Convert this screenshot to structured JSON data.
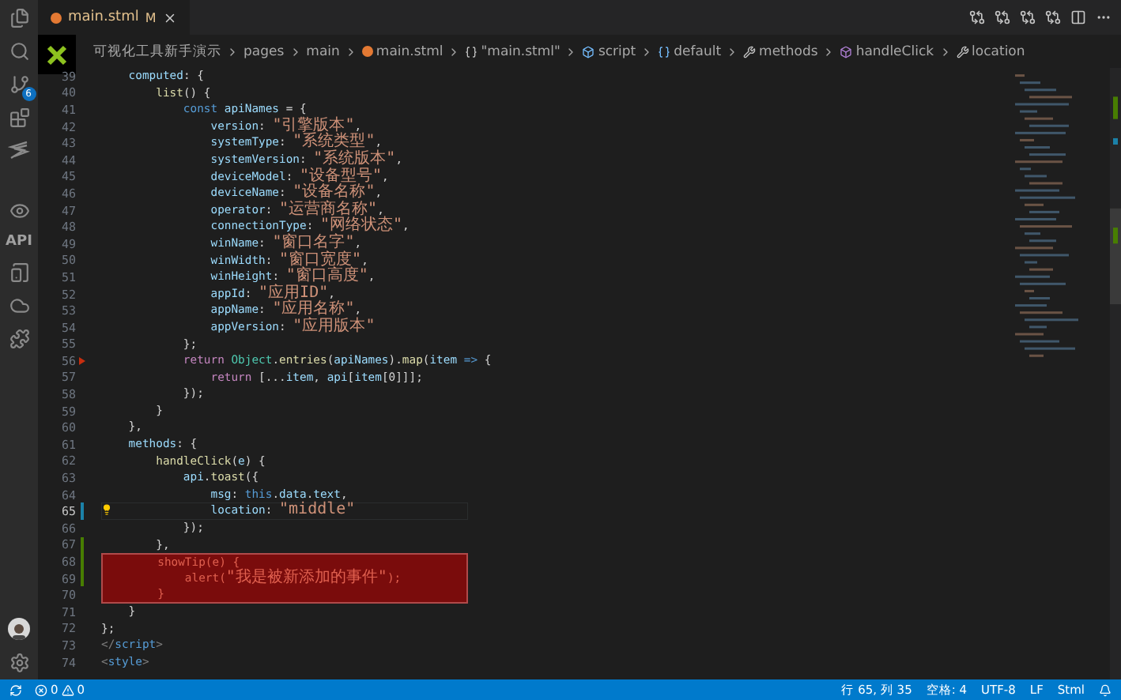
{
  "activity_bar": {
    "scm_badge": "6",
    "api_label": "API"
  },
  "tab": {
    "file_name": "main.stml",
    "status": "M",
    "selected": true
  },
  "breadcrumbs": [
    {
      "kind": "folder",
      "label": "可视化工具新手演示"
    },
    {
      "kind": "folder",
      "label": "pages"
    },
    {
      "kind": "folder",
      "label": "main"
    },
    {
      "kind": "file",
      "label": "main.stml"
    },
    {
      "kind": "module",
      "label": "\"main.stml\""
    },
    {
      "kind": "element",
      "label": "script"
    },
    {
      "kind": "variable",
      "label": "default"
    },
    {
      "kind": "property",
      "label": "methods"
    },
    {
      "kind": "method",
      "label": "handleClick"
    },
    {
      "kind": "property",
      "label": "location"
    }
  ],
  "lines": [
    {
      "number": "39",
      "current": false,
      "highlighted": false,
      "tokens": [
        {
          "kind": "prop",
          "text": "    computed"
        },
        {
          "kind": "punct",
          "text": ": {"
        }
      ]
    },
    {
      "number": "40",
      "current": false,
      "highlighted": false,
      "tokens": [
        {
          "kind": "fn",
          "text": "        list"
        },
        {
          "kind": "punct",
          "text": "() {"
        }
      ]
    },
    {
      "number": "41",
      "current": false,
      "highlighted": false,
      "tokens": [
        {
          "kind": "kw",
          "text": "            const "
        },
        {
          "kind": "var",
          "text": "apiNames"
        },
        {
          "kind": "punct",
          "text": " = {"
        }
      ]
    },
    {
      "number": "42",
      "current": false,
      "highlighted": false,
      "tokens": [
        {
          "kind": "prop",
          "text": "                version"
        },
        {
          "kind": "punct",
          "text": ": "
        },
        {
          "kind": "str",
          "text": "\"引擎版本\""
        },
        {
          "kind": "punct",
          "text": ","
        }
      ]
    },
    {
      "number": "43",
      "current": false,
      "highlighted": false,
      "tokens": [
        {
          "kind": "prop",
          "text": "                systemType"
        },
        {
          "kind": "punct",
          "text": ": "
        },
        {
          "kind": "str",
          "text": "\"系统类型\""
        },
        {
          "kind": "punct",
          "text": ","
        }
      ]
    },
    {
      "number": "44",
      "current": false,
      "highlighted": false,
      "tokens": [
        {
          "kind": "prop",
          "text": "                systemVersion"
        },
        {
          "kind": "punct",
          "text": ": "
        },
        {
          "kind": "str",
          "text": "\"系统版本\""
        },
        {
          "kind": "punct",
          "text": ","
        }
      ]
    },
    {
      "number": "45",
      "current": false,
      "highlighted": false,
      "tokens": [
        {
          "kind": "prop",
          "text": "                deviceModel"
        },
        {
          "kind": "punct",
          "text": ": "
        },
        {
          "kind": "str",
          "text": "\"设备型号\""
        },
        {
          "kind": "punct",
          "text": ","
        }
      ]
    },
    {
      "number": "46",
      "current": false,
      "highlighted": false,
      "tokens": [
        {
          "kind": "prop",
          "text": "                deviceName"
        },
        {
          "kind": "punct",
          "text": ": "
        },
        {
          "kind": "str",
          "text": "\"设备名称\""
        },
        {
          "kind": "punct",
          "text": ","
        }
      ]
    },
    {
      "number": "47",
      "current": false,
      "highlighted": false,
      "tokens": [
        {
          "kind": "prop",
          "text": "                operator"
        },
        {
          "kind": "punct",
          "text": ": "
        },
        {
          "kind": "str",
          "text": "\"运营商名称\""
        },
        {
          "kind": "punct",
          "text": ","
        }
      ]
    },
    {
      "number": "48",
      "current": false,
      "highlighted": false,
      "tokens": [
        {
          "kind": "prop",
          "text": "                connectionType"
        },
        {
          "kind": "punct",
          "text": ": "
        },
        {
          "kind": "str",
          "text": "\"网络状态\""
        },
        {
          "kind": "punct",
          "text": ","
        }
      ]
    },
    {
      "number": "49",
      "current": false,
      "highlighted": false,
      "tokens": [
        {
          "kind": "prop",
          "text": "                winName"
        },
        {
          "kind": "punct",
          "text": ": "
        },
        {
          "kind": "str",
          "text": "\"窗口名字\""
        },
        {
          "kind": "punct",
          "text": ","
        }
      ]
    },
    {
      "number": "50",
      "current": false,
      "highlighted": false,
      "tokens": [
        {
          "kind": "prop",
          "text": "                winWidth"
        },
        {
          "kind": "punct",
          "text": ": "
        },
        {
          "kind": "str",
          "text": "\"窗口宽度\""
        },
        {
          "kind": "punct",
          "text": ","
        }
      ]
    },
    {
      "number": "51",
      "current": false,
      "highlighted": false,
      "tokens": [
        {
          "kind": "prop",
          "text": "                winHeight"
        },
        {
          "kind": "punct",
          "text": ": "
        },
        {
          "kind": "str",
          "text": "\"窗口高度\""
        },
        {
          "kind": "punct",
          "text": ","
        }
      ]
    },
    {
      "number": "52",
      "current": false,
      "highlighted": false,
      "tokens": [
        {
          "kind": "prop",
          "text": "                appId"
        },
        {
          "kind": "punct",
          "text": ": "
        },
        {
          "kind": "str",
          "text": "\"应用ID\""
        },
        {
          "kind": "punct",
          "text": ","
        }
      ]
    },
    {
      "number": "53",
      "current": false,
      "highlighted": false,
      "tokens": [
        {
          "kind": "prop",
          "text": "                appName"
        },
        {
          "kind": "punct",
          "text": ": "
        },
        {
          "kind": "str",
          "text": "\"应用名称\""
        },
        {
          "kind": "punct",
          "text": ","
        }
      ]
    },
    {
      "number": "54",
      "current": false,
      "highlighted": false,
      "tokens": [
        {
          "kind": "prop",
          "text": "                appVersion"
        },
        {
          "kind": "punct",
          "text": ": "
        },
        {
          "kind": "str",
          "text": "\"应用版本\""
        }
      ]
    },
    {
      "number": "55",
      "current": false,
      "highlighted": false,
      "tokens": [
        {
          "kind": "punct",
          "text": "            };"
        }
      ]
    },
    {
      "number": "56",
      "current": false,
      "highlighted": false,
      "kind": "error",
      "tokens": [
        {
          "kind": "ctrl",
          "text": "            return "
        },
        {
          "kind": "cls",
          "text": "Object"
        },
        {
          "kind": "punct",
          "text": "."
        },
        {
          "kind": "fn",
          "text": "entries"
        },
        {
          "kind": "punct",
          "text": "("
        },
        {
          "kind": "var",
          "text": "apiNames"
        },
        {
          "kind": "punct",
          "text": ")."
        },
        {
          "kind": "fn",
          "text": "map"
        },
        {
          "kind": "punct",
          "text": "("
        },
        {
          "kind": "var",
          "text": "item"
        },
        {
          "kind": "kw",
          "text": " => "
        },
        {
          "kind": "punct",
          "text": "{"
        }
      ]
    },
    {
      "number": "57",
      "current": false,
      "highlighted": false,
      "tokens": [
        {
          "kind": "ctrl",
          "text": "                return "
        },
        {
          "kind": "punct",
          "text": "[..."
        },
        {
          "kind": "var",
          "text": "item"
        },
        {
          "kind": "punct",
          "text": ", "
        },
        {
          "kind": "var",
          "text": "api"
        },
        {
          "kind": "punct",
          "text": "["
        },
        {
          "kind": "var",
          "text": "item"
        },
        {
          "kind": "punct",
          "text": "[0]]];"
        }
      ]
    },
    {
      "number": "58",
      "current": false,
      "highlighted": false,
      "tokens": [
        {
          "kind": "punct",
          "text": "            });"
        }
      ]
    },
    {
      "number": "59",
      "current": false,
      "highlighted": false,
      "tokens": [
        {
          "kind": "punct",
          "text": "        }"
        }
      ]
    },
    {
      "number": "60",
      "current": false,
      "highlighted": false,
      "tokens": [
        {
          "kind": "punct",
          "text": "    },"
        }
      ]
    },
    {
      "number": "61",
      "current": false,
      "highlighted": false,
      "tokens": [
        {
          "kind": "prop",
          "text": "    methods"
        },
        {
          "kind": "punct",
          "text": ": {"
        }
      ]
    },
    {
      "number": "62",
      "current": false,
      "highlighted": false,
      "tokens": [
        {
          "kind": "fn",
          "text": "        handleClick"
        },
        {
          "kind": "punct",
          "text": "("
        },
        {
          "kind": "var",
          "text": "e"
        },
        {
          "kind": "punct",
          "text": ") {"
        }
      ]
    },
    {
      "number": "63",
      "current": false,
      "highlighted": false,
      "tokens": [
        {
          "kind": "var",
          "text": "            api"
        },
        {
          "kind": "punct",
          "text": "."
        },
        {
          "kind": "fn",
          "text": "toast"
        },
        {
          "kind": "punct",
          "text": "({"
        }
      ]
    },
    {
      "number": "64",
      "current": false,
      "highlighted": false,
      "tokens": [
        {
          "kind": "prop",
          "text": "                msg"
        },
        {
          "kind": "punct",
          "text": ": "
        },
        {
          "kind": "kw",
          "text": "this"
        },
        {
          "kind": "punct",
          "text": "."
        },
        {
          "kind": "var",
          "text": "data"
        },
        {
          "kind": "punct",
          "text": "."
        },
        {
          "kind": "var",
          "text": "text"
        },
        {
          "kind": "punct",
          "text": ","
        }
      ]
    },
    {
      "number": "65",
      "current": true,
      "highlighted": false,
      "kind": "modified",
      "tokens": [
        {
          "kind": "prop",
          "text": "                location"
        },
        {
          "kind": "punct",
          "text": ": "
        },
        {
          "kind": "str",
          "text": "\"middle\""
        }
      ]
    },
    {
      "number": "66",
      "current": false,
      "highlighted": false,
      "tokens": [
        {
          "kind": "punct",
          "text": "            });"
        }
      ]
    },
    {
      "number": "67",
      "current": false,
      "highlighted": false,
      "kind": "added",
      "tokens": [
        {
          "kind": "punct",
          "text": "        },"
        }
      ]
    },
    {
      "number": "68",
      "current": false,
      "highlighted": true,
      "kind": "added",
      "tokens": [
        {
          "kind": "fn",
          "text": "        showTip"
        },
        {
          "kind": "punct",
          "text": "("
        },
        {
          "kind": "var",
          "text": "e"
        },
        {
          "kind": "punct",
          "text": ") {"
        }
      ]
    },
    {
      "number": "69",
      "current": false,
      "highlighted": true,
      "kind": "added",
      "tokens": [
        {
          "kind": "fn",
          "text": "            alert"
        },
        {
          "kind": "punct",
          "text": "("
        },
        {
          "kind": "str",
          "text": "\"我是被新添加的事件\""
        },
        {
          "kind": "punct",
          "text": ");"
        }
      ]
    },
    {
      "number": "70",
      "current": false,
      "highlighted": true,
      "tokens": [
        {
          "kind": "punct",
          "text": "        }"
        }
      ]
    },
    {
      "number": "71",
      "current": false,
      "highlighted": false,
      "tokens": [
        {
          "kind": "punct",
          "text": "    }"
        }
      ]
    },
    {
      "number": "72",
      "current": false,
      "highlighted": false,
      "tokens": [
        {
          "kind": "punct",
          "text": "};"
        }
      ]
    },
    {
      "number": "73",
      "current": false,
      "highlighted": false,
      "tokens": [
        {
          "kind": "tagp",
          "text": "</"
        },
        {
          "kind": "tag",
          "text": "script"
        },
        {
          "kind": "tagp",
          "text": ">"
        }
      ]
    },
    {
      "number": "74",
      "current": false,
      "highlighted": false,
      "tokens": [
        {
          "kind": "tagp",
          "text": "<"
        },
        {
          "kind": "tag",
          "text": "style"
        },
        {
          "kind": "tagp",
          "text": ">"
        }
      ]
    }
  ],
  "status_bar": {
    "errors": "0",
    "warnings": "0",
    "position": "行 65, 列 35",
    "indent": "空格: 4",
    "encoding": "UTF-8",
    "eol": "LF",
    "language": "Stml"
  }
}
